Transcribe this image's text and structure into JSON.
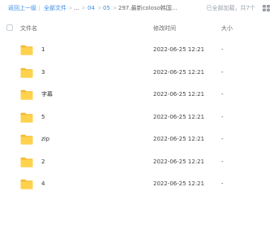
{
  "toolbar": {
    "back_label": "返回上一级",
    "separator": "|",
    "breadcrumbs": [
      "全部文件",
      "...",
      "04",
      "05",
      "297.最新coloso韩国..."
    ],
    "crumb_sep": ">",
    "loaded_info": "已全部加载，共7个"
  },
  "columns": {
    "name": "文件名",
    "modified": "修改时间",
    "size": "大小"
  },
  "files": [
    {
      "name": "1",
      "modified": "2022-06-25 12:21",
      "size": "-"
    },
    {
      "name": "3",
      "modified": "2022-06-25 12:21",
      "size": "-"
    },
    {
      "name": "字幕",
      "modified": "2022-06-25 12:21",
      "size": "-"
    },
    {
      "name": "5",
      "modified": "2022-06-25 12:21",
      "size": "-"
    },
    {
      "name": "zip",
      "modified": "2022-06-25 12:21",
      "size": "-"
    },
    {
      "name": "2",
      "modified": "2022-06-25 12:21",
      "size": "-"
    },
    {
      "name": "4",
      "modified": "2022-06-25 12:21",
      "size": "-"
    }
  ],
  "icons": {
    "folder": "folder-icon",
    "view_toggle": "grid-view-icon"
  },
  "colors": {
    "link": "#3a8ee6",
    "folder": "#ffc83d"
  }
}
